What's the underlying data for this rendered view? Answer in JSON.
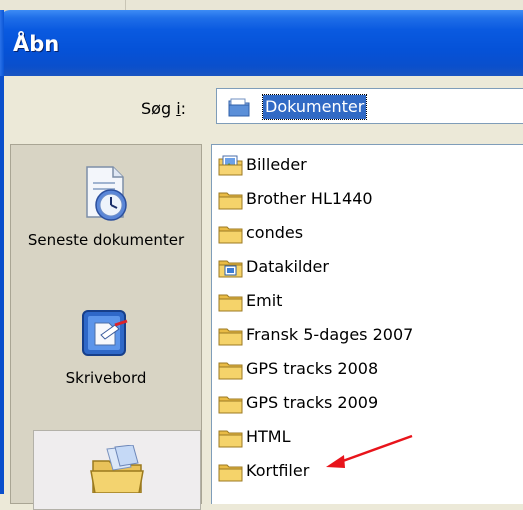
{
  "window": {
    "title": "Åbn"
  },
  "lookin": {
    "label_prefix": "Søg ",
    "label_accel": "i",
    "label_suffix": ":",
    "value": "Dokumenter"
  },
  "places": [
    {
      "label": "Seneste dokumenter",
      "icon": "recent-documents-icon"
    },
    {
      "label": "Skrivebord",
      "icon": "desktop-icon"
    },
    {
      "label": "",
      "icon": "my-documents-icon"
    }
  ],
  "files": [
    {
      "name": "Billeder",
      "icon": "pictures-folder-icon"
    },
    {
      "name": "Brother HL1440",
      "icon": "folder-icon"
    },
    {
      "name": "condes",
      "icon": "folder-icon"
    },
    {
      "name": "Datakilder",
      "icon": "data-sources-folder-icon"
    },
    {
      "name": "Emit",
      "icon": "folder-icon"
    },
    {
      "name": "Fransk 5-dages 2007",
      "icon": "folder-icon"
    },
    {
      "name": "GPS tracks 2008",
      "icon": "folder-icon"
    },
    {
      "name": "GPS tracks 2009",
      "icon": "folder-icon"
    },
    {
      "name": "HTML",
      "icon": "folder-icon"
    },
    {
      "name": "Kortfiler",
      "icon": "folder-icon"
    }
  ],
  "colors": {
    "titlebar": "#0a5ae0",
    "selection": "#316ac5",
    "annotation_arrow": "#e8141b",
    "folder": "#f5d36a"
  }
}
